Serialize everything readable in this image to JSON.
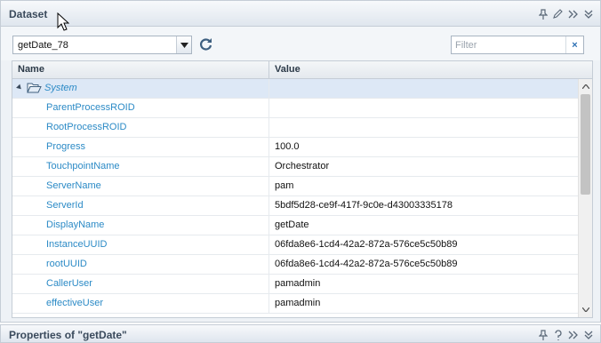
{
  "panel": {
    "title": "Dataset",
    "header_icons": [
      "pin-icon",
      "edit-icon",
      "expand-icon",
      "collapse-icon"
    ]
  },
  "toolbar": {
    "dataset_selected": "getDate_78",
    "filter_placeholder": "Filter",
    "filter_value": "",
    "clear_label": "×"
  },
  "grid": {
    "columns": {
      "name": "Name",
      "value": "Value"
    },
    "group": {
      "label": "System",
      "expanded": true
    },
    "rows": [
      {
        "name": "ParentProcessROID",
        "value": ""
      },
      {
        "name": "RootProcessROID",
        "value": ""
      },
      {
        "name": "Progress",
        "value": "100.0"
      },
      {
        "name": "TouchpointName",
        "value": "Orchestrator"
      },
      {
        "name": "ServerName",
        "value": "pam"
      },
      {
        "name": "ServerId",
        "value": "5bdf5d28-ce9f-417f-9c0e-d43003335178"
      },
      {
        "name": "DisplayName",
        "value": "getDate"
      },
      {
        "name": "InstanceUUID",
        "value": "06fda8e6-1cd4-42a2-872a-576ce5c50b89"
      },
      {
        "name": "rootUUID",
        "value": "06fda8e6-1cd4-42a2-872a-576ce5c50b89"
      },
      {
        "name": "CallerUser",
        "value": "pamadmin"
      },
      {
        "name": "effectiveUser",
        "value": "pamadmin"
      }
    ]
  },
  "properties_panel": {
    "title": "Properties of \"getDate\"",
    "header_icons": [
      "pin-icon",
      "help-icon",
      "expand-icon",
      "collapse-icon"
    ]
  },
  "colors": {
    "link_text": "#2b8ac6",
    "group_row_bg": "#dde8f6",
    "header_text": "#3a4a5c"
  }
}
